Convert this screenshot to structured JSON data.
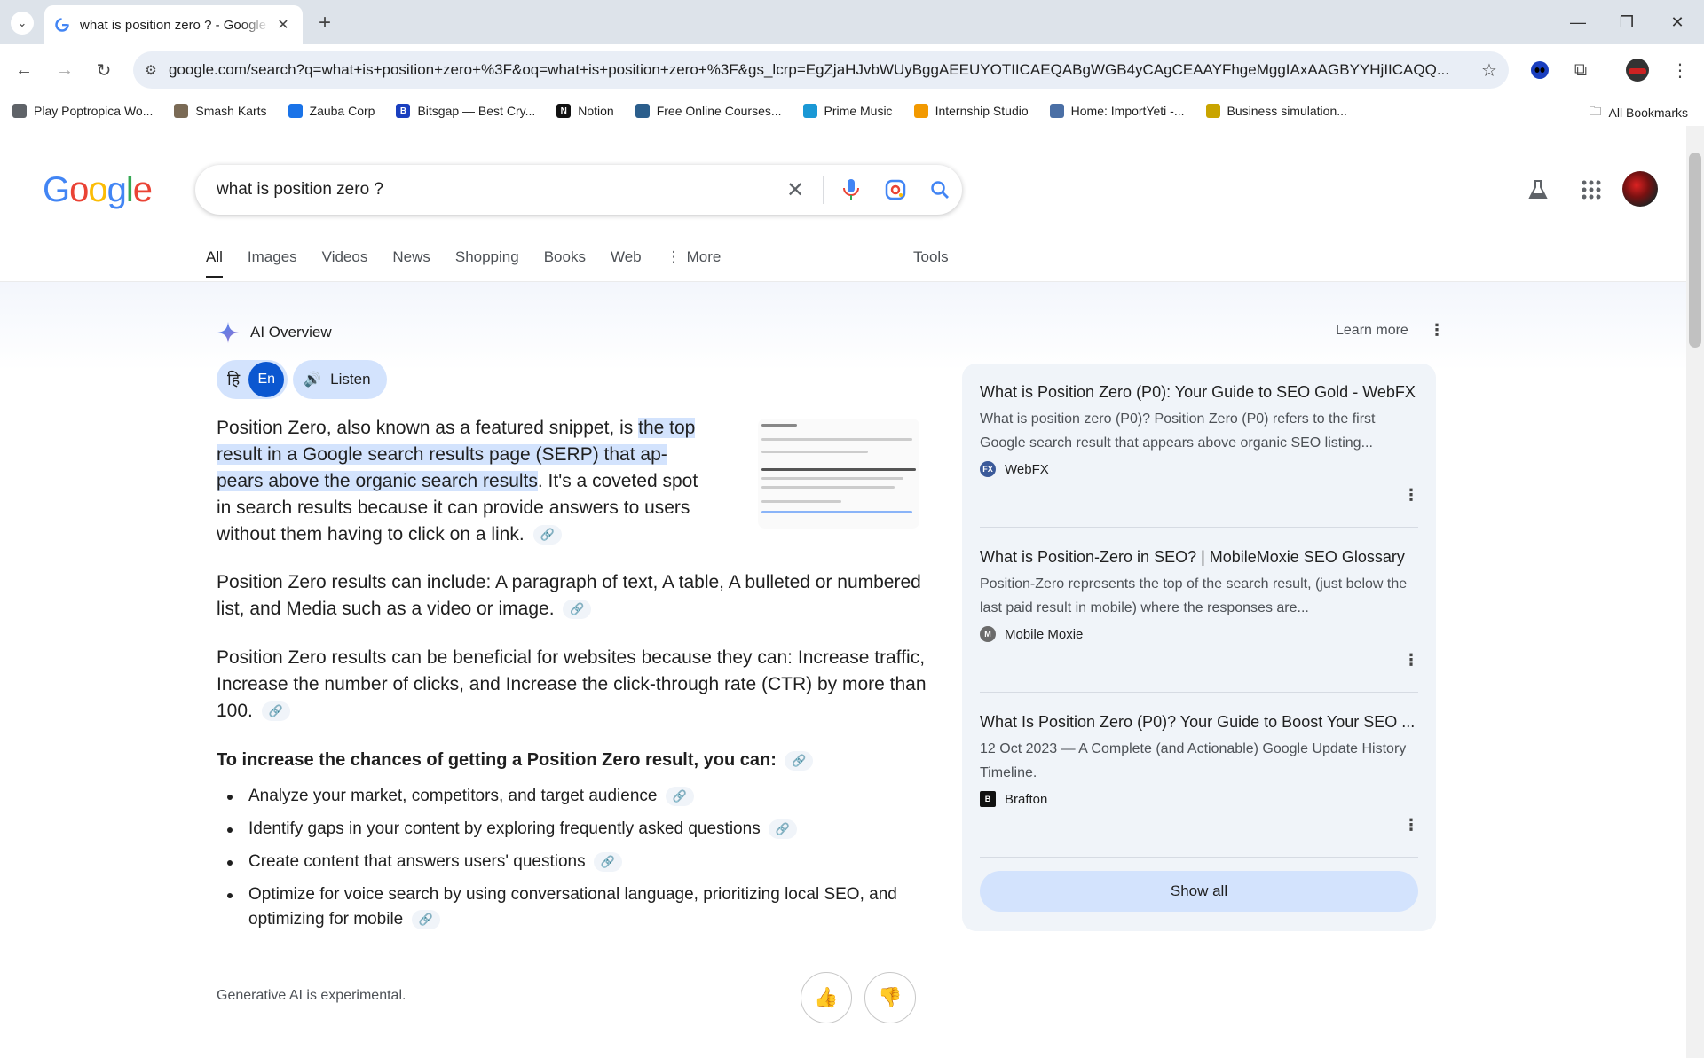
{
  "browser": {
    "tab_title": "what is position zero ? - Google Search",
    "url": "google.com/search?q=what+is+position+zero+%3F&oq=what+is+position+zero+%3F&gs_lcrp=EgZjaHJvbWUyBggAEEUYOTIICAEQABgWGB4yCAgCEAAYFhgeMggIAxAAGBYYHjIICAQQ...",
    "bookmarks": [
      {
        "label": "Play Poptropica Wo...",
        "color": "#5f6368"
      },
      {
        "label": "Smash Karts",
        "color": "#7a6a55"
      },
      {
        "label": "Zauba Corp",
        "color": "#1a73e8"
      },
      {
        "label": "Bitsgap — Best Cry...",
        "color": "#1a3fbf"
      },
      {
        "label": "Notion",
        "color": "#111111"
      },
      {
        "label": "Free Online Courses...",
        "color": "#2b5e8c"
      },
      {
        "label": "Prime Music",
        "color": "#1a98d5"
      },
      {
        "label": "Internship Studio",
        "color": "#f29900"
      },
      {
        "label": "Home: ImportYeti -...",
        "color": "#4a6fa5"
      },
      {
        "label": "Business simulation...",
        "color": "#c9a400"
      }
    ],
    "all_bookmarks": "All Bookmarks"
  },
  "search": {
    "query": "what is position zero ?",
    "tabs": [
      "All",
      "Images",
      "Videos",
      "News",
      "Shopping",
      "Books",
      "Web",
      "More"
    ],
    "tools": "Tools"
  },
  "ai": {
    "header": "AI Overview",
    "learn_more": "Learn more",
    "lang_hi": "हि",
    "lang_en": "En",
    "listen": "Listen",
    "p1_pre": "Position Zero, also known as a featured snippet, is ",
    "p1_hl1": "the top",
    "p1_hl2": "result in a Google search results page (SERP) that ap-",
    "p1_hl3": "pears above the organic search results",
    "p1_post1": ". It's a coveted spot",
    "p1_post2": "in search results because it can provide answers to users",
    "p1_post3": "without them having to click on a link.",
    "p2": "Position Zero results can include: A paragraph of text, A table, A bulleted or numbered list, and Media such as a video or image.",
    "p3": "Position Zero results can be beneficial for websites because they can: Increase traffic, Increase the number of clicks, and Increase the click-through rate (CTR) by more than 100.",
    "p4": "To increase the chances of getting a Position Zero result, you can:",
    "bullets": [
      "Analyze your market, competitors, and target audience",
      "Identify gaps in your content by exploring frequently asked questions",
      "Create content that answers users' questions",
      "Optimize for voice search by using conversational language, prioritizing local SEO, and optimizing for mobile"
    ],
    "disclaimer": "Generative AI is experimental."
  },
  "sources": [
    {
      "title": "What is Position Zero (P0): Your Guide to SEO Gold - WebFX",
      "desc": "What is position zero (P0)? Position Zero (P0) refers to the first Google search result that appears above organic SEO listing...",
      "site": "WebFX",
      "color": "#3b5a9a"
    },
    {
      "title": "What is Position-Zero in SEO? | MobileMoxie SEO Glossary",
      "desc": "Position-Zero represents the top of the search result, (just below the last paid result in mobile) where the responses are...",
      "site": "Mobile Moxie",
      "color": "#6b6b6b"
    },
    {
      "title": "What Is Position Zero (P0)? Your Guide to Boost Your SEO ...",
      "desc": "12 Oct 2023 — A Complete (and Actionable) Google Update History Timeline.",
      "site": "Brafton",
      "color": "#111111"
    }
  ],
  "show_all": "Show all"
}
